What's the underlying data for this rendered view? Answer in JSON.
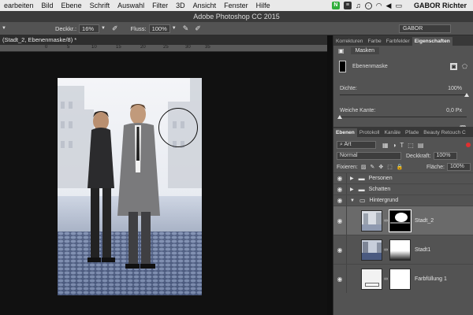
{
  "menu": {
    "items": [
      "earbeiten",
      "Bild",
      "Ebene",
      "Schrift",
      "Auswahl",
      "Filter",
      "3D",
      "Ansicht",
      "Fenster",
      "Hilfe"
    ],
    "user": "GABOR Richter"
  },
  "app_title": "Adobe Photoshop CC 2015",
  "options": {
    "deckkraft_label": "Deckkr.:",
    "deckkraft_value": "16%",
    "fluss_label": "Fluss:",
    "fluss_value": "100%",
    "workspace": "GABOR"
  },
  "document": {
    "tab_title": "(Stadt_2, Ebenenmaske/8) *",
    "ruler_ticks": [
      "0",
      "5",
      "10",
      "15",
      "20",
      "25",
      "30",
      "35"
    ]
  },
  "properties": {
    "tabs": [
      "Korrekturen",
      "Farbe",
      "Farbfelder",
      "Eigenschaften"
    ],
    "active_tab": "Eigenschaften",
    "section": "Masken",
    "mask_label": "Ebenenmaske",
    "density_label": "Dichte:",
    "density_value": "100%",
    "density_fraction": 1.0,
    "feather_label": "Weiche Kante:",
    "feather_value": "0,0 Px",
    "feather_fraction": 0.0
  },
  "layers_panel": {
    "tabs": [
      "Ebenen",
      "Protokoll",
      "Kanäle",
      "Pfade",
      "Beauty Retouch C"
    ],
    "active_tab": "Ebenen",
    "filter_kind": "Art",
    "blend_mode": "Normal",
    "opacity_label": "Deckkraft:",
    "opacity_value": "100%",
    "lock_label": "Fixieren:",
    "fill_label": "Fläche:",
    "fill_value": "100%",
    "layers": [
      {
        "name": "Personen",
        "kind": "group"
      },
      {
        "name": "Schatten",
        "kind": "group"
      },
      {
        "name": "Hintergrund",
        "kind": "group-open"
      },
      {
        "name": "Stadt_2",
        "kind": "masked",
        "selected": true
      },
      {
        "name": "Stadt1",
        "kind": "masked"
      },
      {
        "name": "Farbfüllung 1",
        "kind": "fill"
      }
    ]
  }
}
